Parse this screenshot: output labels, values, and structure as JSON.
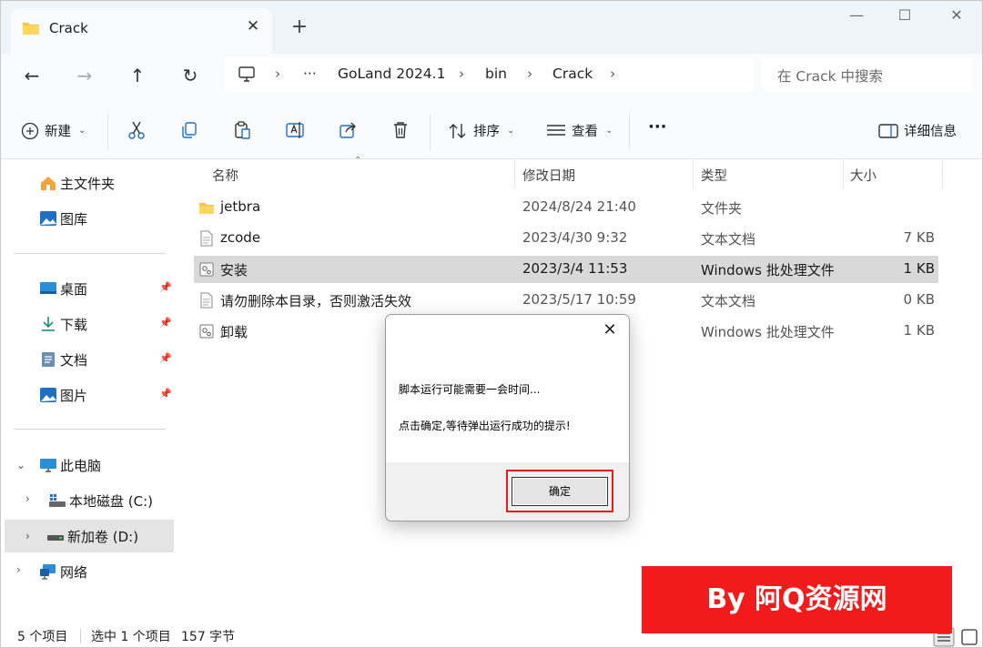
{
  "window": {
    "tab_title": "Crack",
    "new_tab": "+",
    "close_tab": "✕",
    "controls": {
      "minimize": "—",
      "maximize": "☐",
      "close": "✕"
    }
  },
  "nav": {
    "back": "←",
    "forward": "→",
    "up": "↑",
    "refresh": "↻",
    "ellipsis": "···",
    "breadcrumb": [
      "GoLand 2024.1",
      "bin",
      "Crack"
    ],
    "search_placeholder": "在 Crack 中搜索"
  },
  "toolbar": {
    "new_label": "新建",
    "sort_label": "排序",
    "view_label": "查看",
    "more_label": "···",
    "details_label": "详细信息",
    "chevron": "⌄"
  },
  "sidebar": {
    "home": "主文件夹",
    "gallery": "图库",
    "quick": [
      {
        "label": "桌面",
        "icon": "desktop-icon"
      },
      {
        "label": "下载",
        "icon": "download-icon"
      },
      {
        "label": "文档",
        "icon": "document-icon"
      },
      {
        "label": "图片",
        "icon": "pictures-icon"
      }
    ],
    "this_pc": "此电脑",
    "drive_c": "本地磁盘 (C:)",
    "drive_d": "新加卷 (D:)",
    "network": "网络"
  },
  "columns": {
    "name": "名称",
    "modified": "修改日期",
    "type": "类型",
    "size": "大小"
  },
  "files": [
    {
      "name": "jetbra",
      "modified": "2024/8/24 21:40",
      "type": "文件夹",
      "size": "",
      "icon": "folder-icon"
    },
    {
      "name": "zcode",
      "modified": "2023/4/30 9:32",
      "type": "文本文档",
      "size": "7 KB",
      "icon": "text-file-icon"
    },
    {
      "name": "安装",
      "modified": "2023/3/4 11:53",
      "type": "Windows 批处理文件",
      "size": "1 KB",
      "icon": "batch-file-icon"
    },
    {
      "name": "请勿删除本目录，否则激活失效",
      "modified": "2023/5/17 10:59",
      "type": "文本文档",
      "size": "0 KB",
      "icon": "text-file-icon"
    },
    {
      "name": "卸载",
      "modified": "",
      "type": "Windows 批处理文件",
      "size": "1 KB",
      "icon": "batch-file-icon"
    }
  ],
  "status": {
    "count": "5 个项目",
    "selection": "选中 1 个项目",
    "size": "157 字节"
  },
  "dialog": {
    "line1": "脚本运行可能需要一会时间...",
    "line2": "点击确定,等待弹出运行成功的提示!",
    "ok_label": "确定",
    "close": "✕"
  },
  "watermark": "By 阿Q资源网",
  "colors": {
    "accent": "#0067c0",
    "watermark": "#f21a1a",
    "selection": "#d9d9d9",
    "folder": "#f7c33b"
  }
}
